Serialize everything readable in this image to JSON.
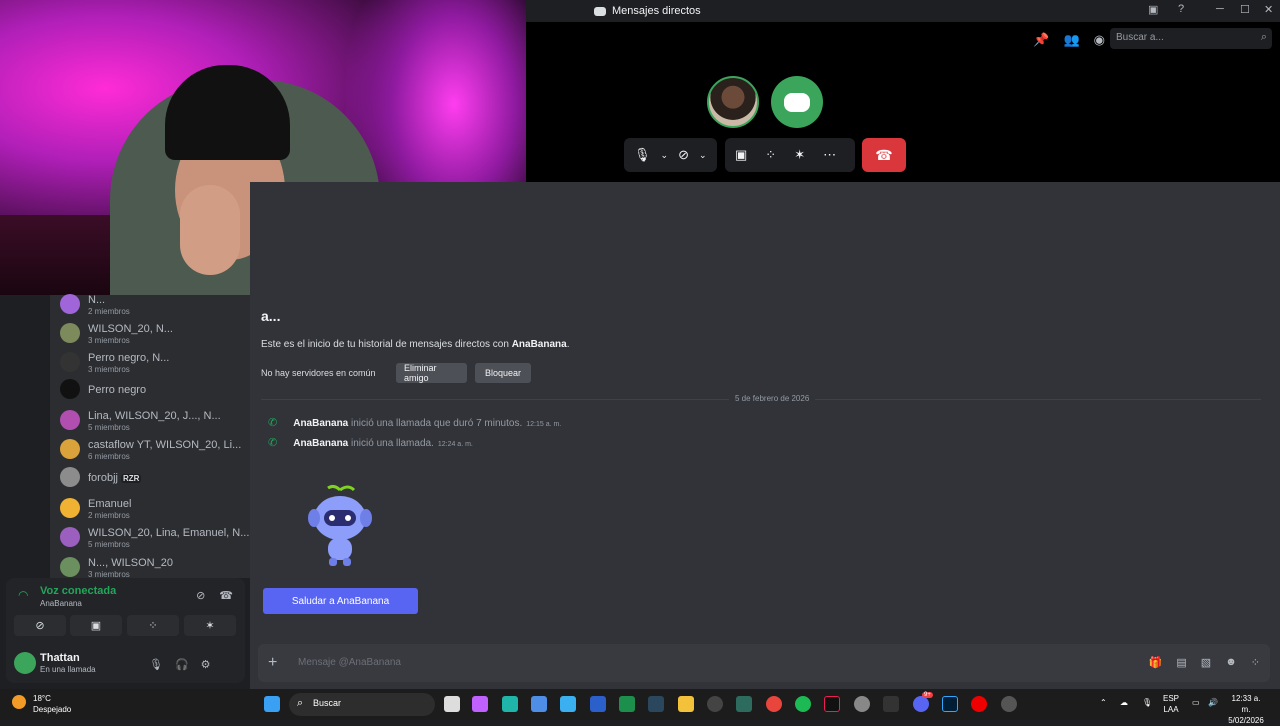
{
  "window": {
    "title": "Mensajes directos",
    "controls": [
      "─",
      "☐",
      "✕"
    ]
  },
  "header": {
    "search_placeholder": "Buscar a...",
    "icons": [
      "pin-icon",
      "add-friend-icon",
      "profile-icon"
    ]
  },
  "call": {
    "controls": [
      "microphone-icon",
      "chevron-down-icon",
      "camera-off-icon",
      "chevron-down-icon",
      "screen-share-icon",
      "activities-icon",
      "soundboard-icon",
      "more-icon"
    ],
    "hangup_icon": "hangup-icon"
  },
  "dm_list": [
    {
      "name": "N...",
      "sub": "2 miembros",
      "color": "#a066d9"
    },
    {
      "name": "WILSON_20, N...",
      "sub": "3 miembros",
      "color": "#7d8a5c"
    },
    {
      "name": "Perro negro, N...",
      "sub": "3 miembros",
      "color": "#333333"
    },
    {
      "name": "Perro negro",
      "sub": "",
      "color": "#111111"
    },
    {
      "name": "Lina, WILSON_20, J..., N...",
      "sub": "5 miembros",
      "color": "#b14fb0"
    },
    {
      "name": "castaflow YT, WILSON_20, Li...",
      "sub": "6 miembros",
      "color": "#d9a23a"
    },
    {
      "name": "forobjj",
      "sub": "",
      "tag": "RZR",
      "color": "#8c8c8c"
    },
    {
      "name": "Emanuel",
      "sub": "2 miembros",
      "color": "#f0b232"
    },
    {
      "name": "WILSON_20, Lina, Emanuel, N...",
      "sub": "5 miembros",
      "color": "#9a5fbf"
    },
    {
      "name": "N..., WILSON_20",
      "sub": "3 miembros",
      "color": "#6b8f5e"
    }
  ],
  "voice": {
    "status": "Voz conectada",
    "channel": "AnaBanana",
    "buttons": [
      "camera-off-icon",
      "screen-share-icon",
      "activities-icon",
      "soundboard-icon"
    ]
  },
  "user": {
    "name": "Thattan",
    "status": "En una llamada"
  },
  "chat": {
    "title": "a...",
    "intro_prefix": "Este es el inicio de tu historial de mensajes directos con ",
    "intro_name": "AnaBanana",
    "intro_suffix": ".",
    "no_servers": "No hay servidores en común",
    "remove_friend": "Eliminar amigo",
    "block": "Bloquear",
    "date_divider": "5 de febrero de 2026",
    "messages": [
      {
        "author": "AnaBanana",
        "text": " inició una llamada que duró 7 minutos.",
        "time": "12:15 a. m."
      },
      {
        "author": "AnaBanana",
        "text": " inició una llamada.",
        "time": "12:24 a. m."
      }
    ],
    "wave_button": "Saludar a AnaBanana",
    "composer_placeholder": "Mensaje @AnaBanana"
  },
  "taskbar": {
    "temp": "18°C",
    "condition": "Despejado",
    "search": "Buscar",
    "lang_top": "ESP",
    "lang_bottom": "LAA",
    "time": "12:33 a. m.",
    "date": "5/02/2026",
    "badge": "9+"
  }
}
